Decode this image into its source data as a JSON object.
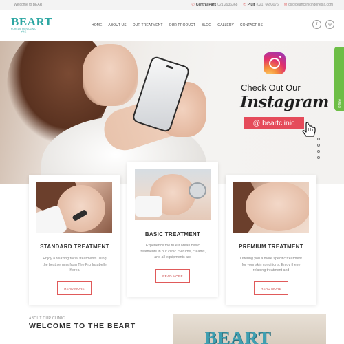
{
  "topbar": {
    "welcome": "Welcome to BEART",
    "location_label": "Central Park",
    "location_phone": "021 2936368",
    "pluit_label": "Pluit",
    "pluit_phone": "(021) 6693076",
    "email": "cs@beartclinicindonesia.com"
  },
  "header": {
    "logo_text": "BEART",
    "logo_tagline": "KOREAN SKIN CLINIC",
    "logo_korean": "뷰아트"
  },
  "nav": [
    "HOME",
    "ABOUT US",
    "OUR TREATMENT",
    "OUR PRODUCT",
    "BLOG",
    "GALLERY",
    "CONTACT US"
  ],
  "social": {
    "facebook_glyph": "f",
    "instagram_glyph": "◎"
  },
  "hero": {
    "check_out": "Check Out Our",
    "instagram_word": "Instagram",
    "handle": "@ beartclinic"
  },
  "offline_tab": "Offline",
  "cards": [
    {
      "title": "STANDARD TREATMENT",
      "text": "Enjoy a relaxing facial treatments using the best serums from The Pro Insubelle Korea",
      "button": "READ MORE"
    },
    {
      "title": "BASIC TREATMENT",
      "text": "Experience the true Korean basic treatments in our clinic. Serums, creams, and all equipments are",
      "button": "READ MORE"
    },
    {
      "title": "PREMIUM TREATMENT",
      "text": "Offering you a more specific treatment for your skin conditions. Enjoy these relaxing treatment and",
      "button": "READ MORE"
    }
  ],
  "about": {
    "small": "ABOUT OUR CLINIC",
    "title": "WELCOME TO THE BEART",
    "sign_text": "BEART"
  },
  "colors": {
    "accent_red": "#e05a5a",
    "brand_teal": "#2ea7a3",
    "offline_green": "#6dbe46"
  }
}
